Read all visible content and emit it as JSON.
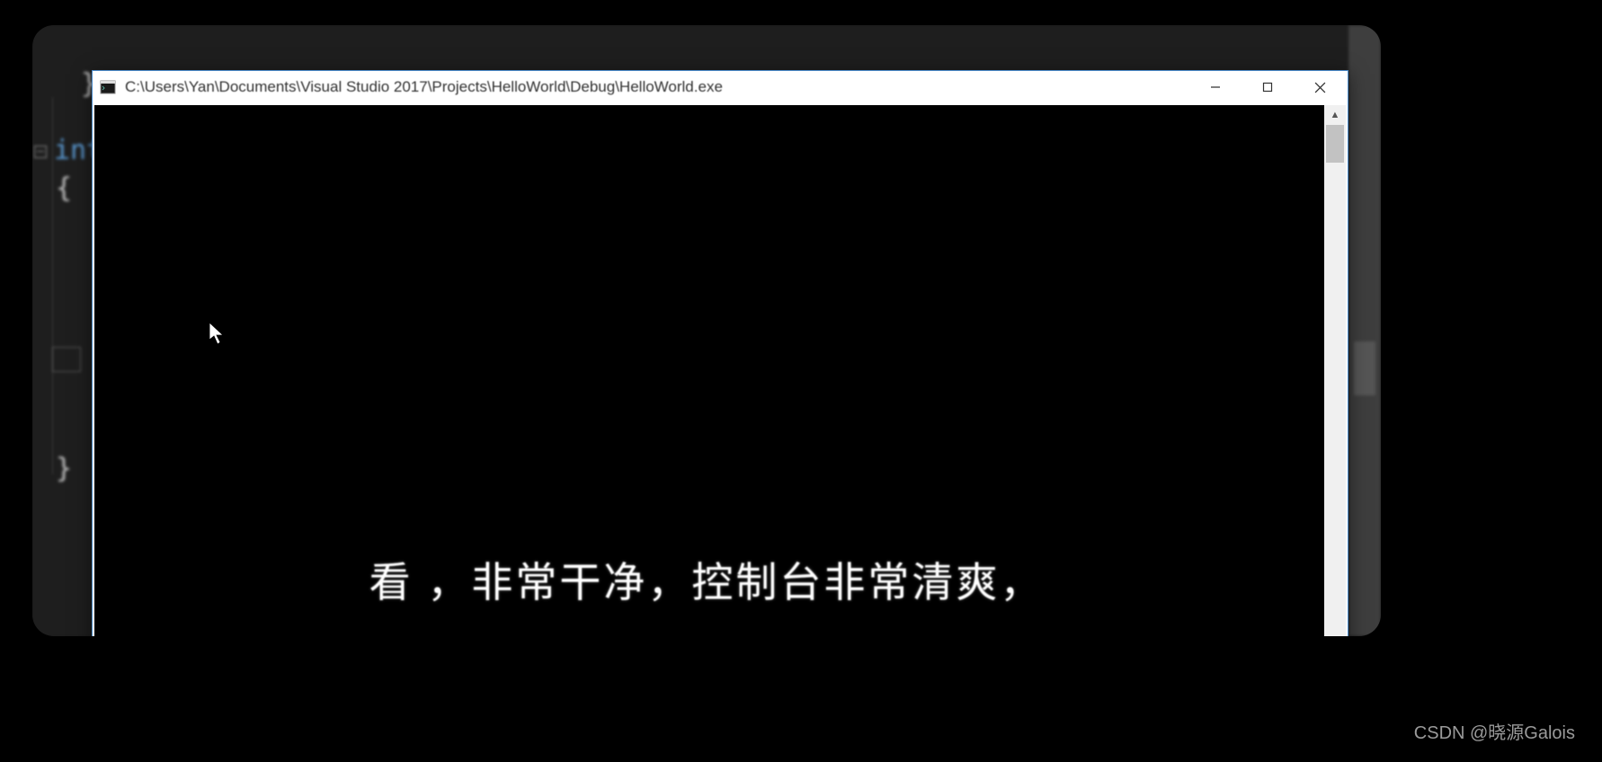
{
  "editor": {
    "code_fragment_top": "};",
    "keyword": "int",
    "brace_open": "{",
    "brace_close": "}"
  },
  "console": {
    "title": "C:\\Users\\Yan\\Documents\\Visual Studio 2017\\Projects\\HelloWorld\\Debug\\HelloWorld.exe",
    "icon_name": "console-app-icon",
    "minimize_label": "Minimize",
    "maximize_label": "Maximize",
    "close_label": "Close",
    "scroll_up": "▲"
  },
  "subtitle_text": "看 ，非常干净，控制台非常清爽，",
  "watermark": "CSDN @晓源Galois"
}
